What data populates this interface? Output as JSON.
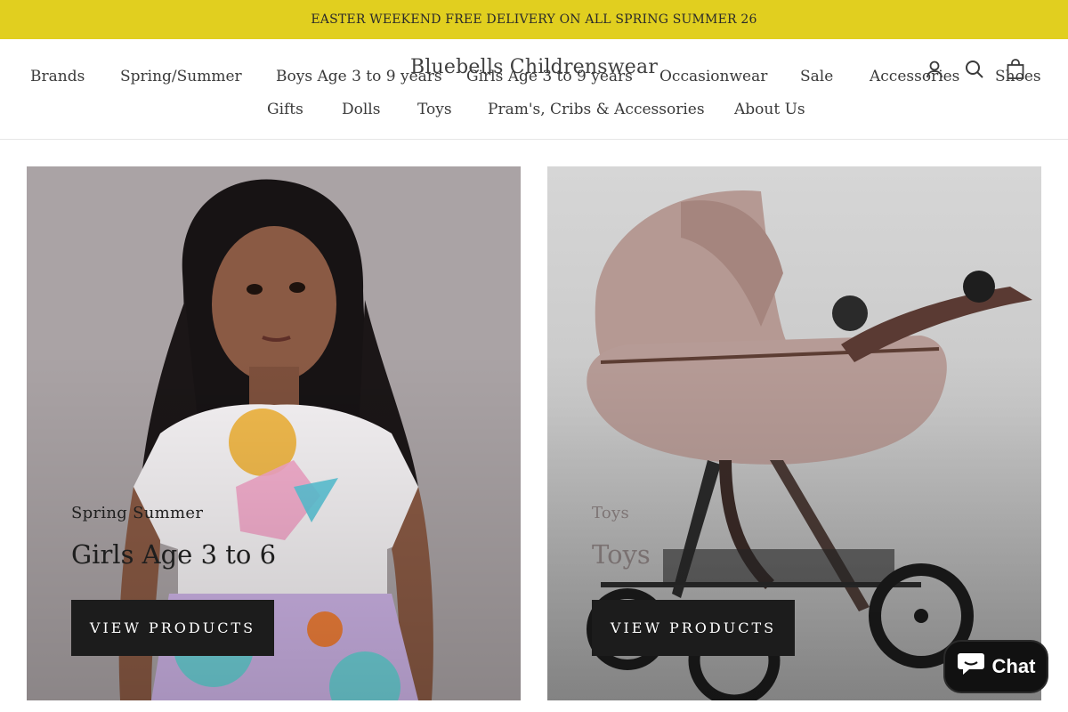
{
  "announcement": "EASTER WEEKEND FREE DELIVERY ON ALL SPRING SUMMER 26",
  "brand": "Bluebells Childrenswear",
  "nav": {
    "row1": [
      "Brands",
      "Spring/Summer",
      "Boys Age 3 to 9 years",
      "Girls Age 3 to 9 years",
      "Occasionwear",
      "Sale",
      "Accessories",
      "Shoes"
    ],
    "row2": [
      "Gifts",
      "Dolls",
      "Toys",
      "Pram's, Cribs & Accessories",
      "About Us"
    ]
  },
  "header_icons": [
    "account-icon",
    "search-icon",
    "cart-icon"
  ],
  "tiles": [
    {
      "subtitle": "Spring Summer",
      "title": "Girls Age 3 to 6",
      "button": "VIEW PRODUCTS",
      "image": "girl-in-white-tshirt-photo"
    },
    {
      "subtitle": "Toys",
      "title": "Toys",
      "button": "VIEW PRODUCTS",
      "image": "pink-doll-pram-photo"
    }
  ],
  "chat": {
    "label": "Chat",
    "icon": "chat-bubble-icon"
  },
  "colors": {
    "announcement_bg": "#e1cf1f",
    "button_bg": "#1c1c1c",
    "chat_bg": "#111111"
  }
}
